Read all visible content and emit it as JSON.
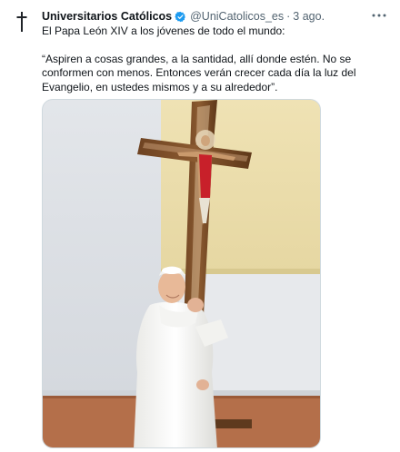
{
  "tweet": {
    "author_name": "Universitarios Católicos",
    "handle": "@UniCatolicos_es",
    "separator": "·",
    "time": "3 ago.",
    "text_line1": "El Papa León XIV a los jóvenes de todo el mundo:",
    "text_quote": "“Aspiren a cosas grandes, a la santidad, allí donde estén. No se conformen con menos. Entonces verán crecer cada día la luz del Evangelio, en ustedes mismos y a su alrededor”."
  },
  "icons": {
    "avatar": "cross-icon",
    "verified": "verified-badge-icon",
    "more": "more-options-icon"
  },
  "colors": {
    "verified_blue": "#1d9bf0",
    "secondary_text": "#536471",
    "primary_text": "#0f1419"
  }
}
